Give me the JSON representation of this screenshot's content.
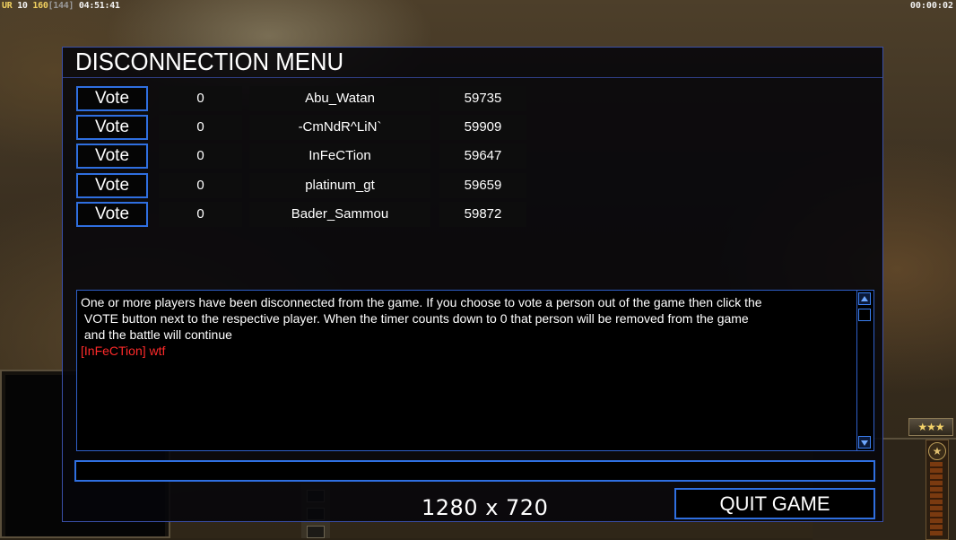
{
  "hud": {
    "top_left": {
      "ur": "UR",
      "level": "10",
      "money": "160",
      "bracket": "[144]",
      "time": "04:51:41"
    },
    "top_right_timer": "00:00:02",
    "rank_stars": "★★★",
    "rank_icon": "star-icon"
  },
  "dialog": {
    "title": "DISCONNECTION MENU",
    "players": [
      {
        "vote_label": "Vote",
        "timer": "0",
        "name": "Abu_Watan",
        "ping": "59735"
      },
      {
        "vote_label": "Vote",
        "timer": "0",
        "name": "-CmNdR^LiN`",
        "ping": "59909"
      },
      {
        "vote_label": "Vote",
        "timer": "0",
        "name": "InFeCTion",
        "ping": "59647"
      },
      {
        "vote_label": "Vote",
        "timer": "0",
        "name": "platinum_gt",
        "ping": "59659"
      },
      {
        "vote_label": "Vote",
        "timer": "0",
        "name": "Bader_Sammou",
        "ping": "59872"
      }
    ],
    "message": {
      "line1": "One or more players have been disconnected from the game. If you choose to vote a person out of the game then click the",
      "line2": " VOTE button next to the respective player. When the timer counts down to 0 that person will be removed from the game",
      "line3": " and the battle will continue",
      "chat": "[InFeCTion] wtf"
    },
    "chat_input_value": "",
    "quit_label": "QUIT GAME"
  },
  "overlay_resolution": "1280 x 720",
  "colors": {
    "accent_border": "#2f6fe0",
    "chat_text": "#ff2a2a",
    "gold": "#f0d060"
  }
}
